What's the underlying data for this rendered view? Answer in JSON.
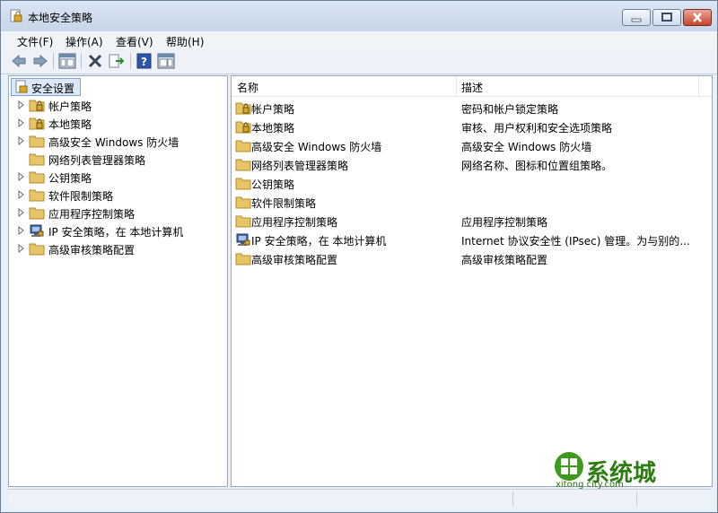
{
  "window": {
    "title": "本地安全策略"
  },
  "menu": {
    "items": [
      {
        "label": "文件(F)"
      },
      {
        "label": "操作(A)"
      },
      {
        "label": "查看(V)"
      },
      {
        "label": "帮助(H)"
      }
    ]
  },
  "toolbar": {
    "buttons": [
      "back-arrow-icon",
      "forward-arrow-icon",
      "show-hide-tree-icon",
      "delete-icon",
      "export-list-icon",
      "help-icon",
      "show-action-pane-icon"
    ]
  },
  "tree": {
    "root_label": "安全设置",
    "items": [
      {
        "label": "帐户策略",
        "icon": "folder-lock-icon",
        "expandable": true
      },
      {
        "label": "本地策略",
        "icon": "folder-lock-icon",
        "expandable": true
      },
      {
        "label": "高级安全 Windows 防火墙",
        "icon": "folder-icon",
        "expandable": true
      },
      {
        "label": "网络列表管理器策略",
        "icon": "folder-icon",
        "expandable": false
      },
      {
        "label": "公钥策略",
        "icon": "folder-icon",
        "expandable": true
      },
      {
        "label": "软件限制策略",
        "icon": "folder-icon",
        "expandable": true
      },
      {
        "label": "应用程序控制策略",
        "icon": "folder-icon",
        "expandable": true
      },
      {
        "label": "IP 安全策略，在 本地计算机",
        "icon": "ip-security-icon",
        "expandable": true
      },
      {
        "label": "高级审核策略配置",
        "icon": "folder-icon",
        "expandable": true
      }
    ]
  },
  "list": {
    "columns": {
      "name": "名称",
      "desc": "描述"
    },
    "rows": [
      {
        "name": "帐户策略",
        "desc": "密码和帐户锁定策略",
        "icon": "folder-lock-icon"
      },
      {
        "name": "本地策略",
        "desc": "审核、用户权利和安全选项策略",
        "icon": "folder-lock-icon"
      },
      {
        "name": "高级安全 Windows 防火墙",
        "desc": "高级安全 Windows 防火墙",
        "icon": "folder-icon"
      },
      {
        "name": "网络列表管理器策略",
        "desc": "网络名称、图标和位置组策略。",
        "icon": "folder-icon"
      },
      {
        "name": "公钥策略",
        "desc": "",
        "icon": "folder-icon"
      },
      {
        "name": "软件限制策略",
        "desc": "",
        "icon": "folder-icon"
      },
      {
        "name": "应用程序控制策略",
        "desc": "应用程序控制策略",
        "icon": "folder-icon"
      },
      {
        "name": "IP 安全策略，在 本地计算机",
        "desc": "Internet 协议安全性 (IPsec) 管理。为与别的...",
        "icon": "ip-security-icon"
      },
      {
        "name": "高级审核策略配置",
        "desc": "高级审核策略配置",
        "icon": "folder-icon"
      }
    ]
  },
  "watermark": {
    "text": "系统城",
    "url": "xitong city.com"
  },
  "colors": {
    "folder": "#e7c566",
    "selection": "#dbe8f8",
    "watermark": "#2d7d12"
  }
}
